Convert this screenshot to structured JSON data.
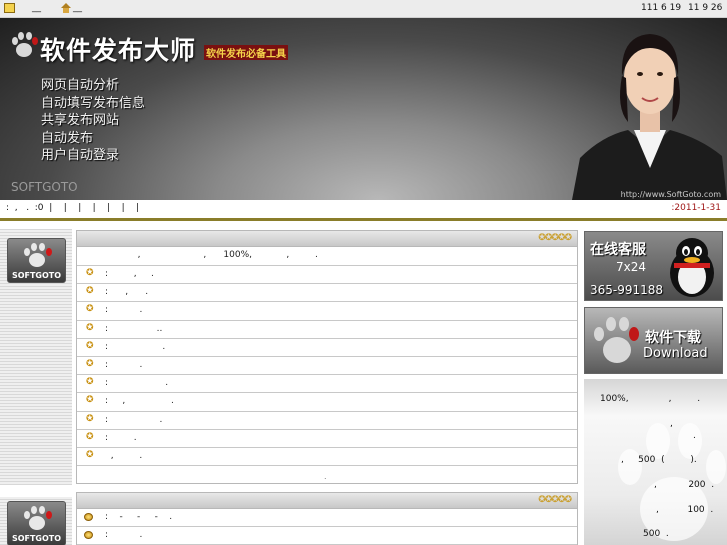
{
  "topbar": {
    "left_text_1": "__",
    "left_text_2": "__",
    "date_text": "111 6 19",
    "time_text": "11 9 26"
  },
  "banner": {
    "title": "软件发布大师",
    "subtitle": "软件发布必备工具",
    "features": [
      "网页自动分析",
      "自动填写发布信息",
      "共享发布网站",
      "自动发布",
      "用户自动登录"
    ],
    "brand": "SOFTGOTO",
    "url": "http://www.SoftGoto.com"
  },
  "navbar": {
    "left_text": ":  ,   .  :0  |    |    |    |    |    |    |",
    "date": ":2011-1-31"
  },
  "left_logo_text": "SOFTGOTO",
  "panel1": {
    "stars": "✪✪✪✪✪",
    "intro": "          ,                      ,      100%,            ,         .",
    "rows": [
      ":         ,     .",
      ":      ,      .",
      ":           .",
      ":                 ..",
      ":                   .",
      ":           .",
      ":                    .",
      ":     ,                .",
      ":                  .",
      ":         .",
      "  ,         ."
    ],
    "foot": "."
  },
  "panel2": {
    "stars": "✪✪✪✪✪",
    "rows": [
      ":    -     -     -    .",
      ":           ."
    ]
  },
  "right": {
    "online_title": "在线客服",
    "online_hours": "7x24",
    "online_phone": "365-991188",
    "download_cn": "软件下载",
    "download_en": "Download",
    "info": [
      "100%,              ,         .",
      ",",
      ".",
      ",     500  (         ).",
      ",           200  .",
      ",          100  .",
      "500  ."
    ]
  }
}
